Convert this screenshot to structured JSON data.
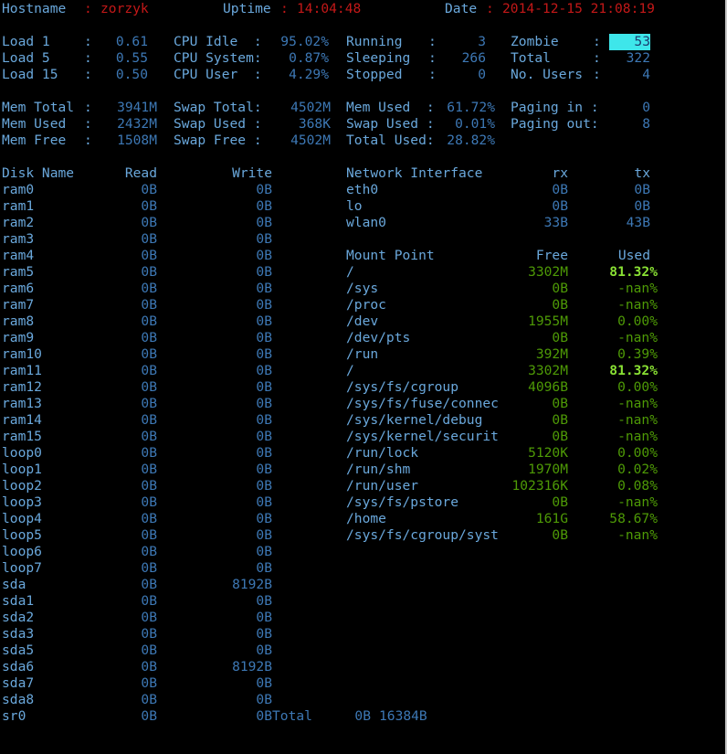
{
  "header": {
    "hostname_label": "Hostname",
    "hostname": "zorzyk",
    "uptime_label": "Uptime",
    "uptime": "14:04:48",
    "date_label": "Date",
    "date": "2014-12-15 21:08:19",
    "sep": ":"
  },
  "load": [
    {
      "label": "Load 1",
      "value": "0.61"
    },
    {
      "label": "Load 5",
      "value": "0.55"
    },
    {
      "label": "Load 15",
      "value": "0.50"
    }
  ],
  "cpu": [
    {
      "label": "CPU Idle  :",
      "value": "95.02%"
    },
    {
      "label": "CPU System:",
      "value": "0.87%"
    },
    {
      "label": "CPU User  :",
      "value": "4.29%"
    }
  ],
  "procs": [
    {
      "label": "Running",
      "value": "3"
    },
    {
      "label": "Sleeping",
      "value": "266"
    },
    {
      "label": "Stopped",
      "value": "0"
    }
  ],
  "procs2": [
    {
      "label": "Zombie",
      "value": "53"
    },
    {
      "label": "Total",
      "value": "322"
    },
    {
      "label": "No. Users",
      "value": "4"
    }
  ],
  "mem": [
    {
      "label": "Mem Total",
      "value": "3941M"
    },
    {
      "label": "Mem Used",
      "value": "2432M"
    },
    {
      "label": "Mem Free",
      "value": "1508M"
    }
  ],
  "swap": [
    {
      "label": "Swap Total:",
      "value": "4502M"
    },
    {
      "label": "Swap Used :",
      "value": "368K"
    },
    {
      "label": "Swap Free :",
      "value": "4502M"
    }
  ],
  "usage": [
    {
      "label": "Mem Used  :",
      "value": "61.72%"
    },
    {
      "label": "Swap Used :",
      "value": "0.01%"
    },
    {
      "label": "Total Used:",
      "value": "28.82%"
    }
  ],
  "paging": [
    {
      "label": "Paging in :",
      "value": "0"
    },
    {
      "label": "Paging out:",
      "value": "8"
    }
  ],
  "disk": {
    "headers": {
      "name": "Disk Name",
      "read": "Read",
      "write": "Write"
    },
    "rows": [
      {
        "name": "ram0",
        "read": "0B",
        "write": "0B"
      },
      {
        "name": "ram1",
        "read": "0B",
        "write": "0B"
      },
      {
        "name": "ram2",
        "read": "0B",
        "write": "0B"
      },
      {
        "name": "ram3",
        "read": "0B",
        "write": "0B"
      },
      {
        "name": "ram4",
        "read": "0B",
        "write": "0B"
      },
      {
        "name": "ram5",
        "read": "0B",
        "write": "0B"
      },
      {
        "name": "ram6",
        "read": "0B",
        "write": "0B"
      },
      {
        "name": "ram7",
        "read": "0B",
        "write": "0B"
      },
      {
        "name": "ram8",
        "read": "0B",
        "write": "0B"
      },
      {
        "name": "ram9",
        "read": "0B",
        "write": "0B"
      },
      {
        "name": "ram10",
        "read": "0B",
        "write": "0B"
      },
      {
        "name": "ram11",
        "read": "0B",
        "write": "0B"
      },
      {
        "name": "ram12",
        "read": "0B",
        "write": "0B"
      },
      {
        "name": "ram13",
        "read": "0B",
        "write": "0B"
      },
      {
        "name": "ram14",
        "read": "0B",
        "write": "0B"
      },
      {
        "name": "ram15",
        "read": "0B",
        "write": "0B"
      },
      {
        "name": "loop0",
        "read": "0B",
        "write": "0B"
      },
      {
        "name": "loop1",
        "read": "0B",
        "write": "0B"
      },
      {
        "name": "loop2",
        "read": "0B",
        "write": "0B"
      },
      {
        "name": "loop3",
        "read": "0B",
        "write": "0B"
      },
      {
        "name": "loop4",
        "read": "0B",
        "write": "0B"
      },
      {
        "name": "loop5",
        "read": "0B",
        "write": "0B"
      },
      {
        "name": "loop6",
        "read": "0B",
        "write": "0B"
      },
      {
        "name": "loop7",
        "read": "0B",
        "write": "0B"
      },
      {
        "name": "sda",
        "read": "0B",
        "write": "8192B"
      },
      {
        "name": "sda1",
        "read": "0B",
        "write": "0B"
      },
      {
        "name": "sda2",
        "read": "0B",
        "write": "0B"
      },
      {
        "name": "sda3",
        "read": "0B",
        "write": "0B"
      },
      {
        "name": "sda5",
        "read": "0B",
        "write": "0B"
      },
      {
        "name": "sda6",
        "read": "0B",
        "write": "8192B"
      },
      {
        "name": "sda7",
        "read": "0B",
        "write": "0B"
      },
      {
        "name": "sda8",
        "read": "0B",
        "write": "0B"
      },
      {
        "name": "sr0",
        "read": "0B",
        "write": "0B"
      }
    ],
    "total": {
      "label": "Total",
      "read": "0B",
      "write": "16384B"
    }
  },
  "network": {
    "headers": {
      "iface": "Network Interface",
      "rx": "rx",
      "tx": "tx"
    },
    "rows": [
      {
        "iface": "eth0",
        "rx": "0B",
        "tx": "0B"
      },
      {
        "iface": "lo",
        "rx": "0B",
        "tx": "0B"
      },
      {
        "iface": "wlan0",
        "rx": "33B",
        "tx": "43B"
      }
    ]
  },
  "mounts": {
    "headers": {
      "point": "Mount Point",
      "free": "Free",
      "used": "Used"
    },
    "rows": [
      {
        "point": "/",
        "free": "3302M",
        "used": "81.32%"
      },
      {
        "point": "/sys",
        "free": "0B",
        "used": "-nan%"
      },
      {
        "point": "/proc",
        "free": "0B",
        "used": "-nan%"
      },
      {
        "point": "/dev",
        "free": "1955M",
        "used": "0.00%"
      },
      {
        "point": "/dev/pts",
        "free": "0B",
        "used": "-nan%"
      },
      {
        "point": "/run",
        "free": "392M",
        "used": "0.39%"
      },
      {
        "point": "/",
        "free": "3302M",
        "used": "81.32%"
      },
      {
        "point": "/sys/fs/cgroup",
        "free": "4096B",
        "used": "0.00%"
      },
      {
        "point": "/sys/fs/fuse/connec",
        "free": "0B",
        "used": "-nan%"
      },
      {
        "point": "/sys/kernel/debug",
        "free": "0B",
        "used": "-nan%"
      },
      {
        "point": "/sys/kernel/securit",
        "free": "0B",
        "used": "-nan%"
      },
      {
        "point": "/run/lock",
        "free": "5120K",
        "used": "0.00%"
      },
      {
        "point": "/run/shm",
        "free": "1970M",
        "used": "0.02%"
      },
      {
        "point": "/run/user",
        "free": "102316K",
        "used": "0.08%"
      },
      {
        "point": "/sys/fs/pstore",
        "free": "0B",
        "used": "-nan%"
      },
      {
        "point": "/home",
        "free": "161G",
        "used": "58.67%"
      },
      {
        "point": "/sys/fs/cgroup/syst",
        "free": "0B",
        "used": "-nan%"
      }
    ]
  }
}
